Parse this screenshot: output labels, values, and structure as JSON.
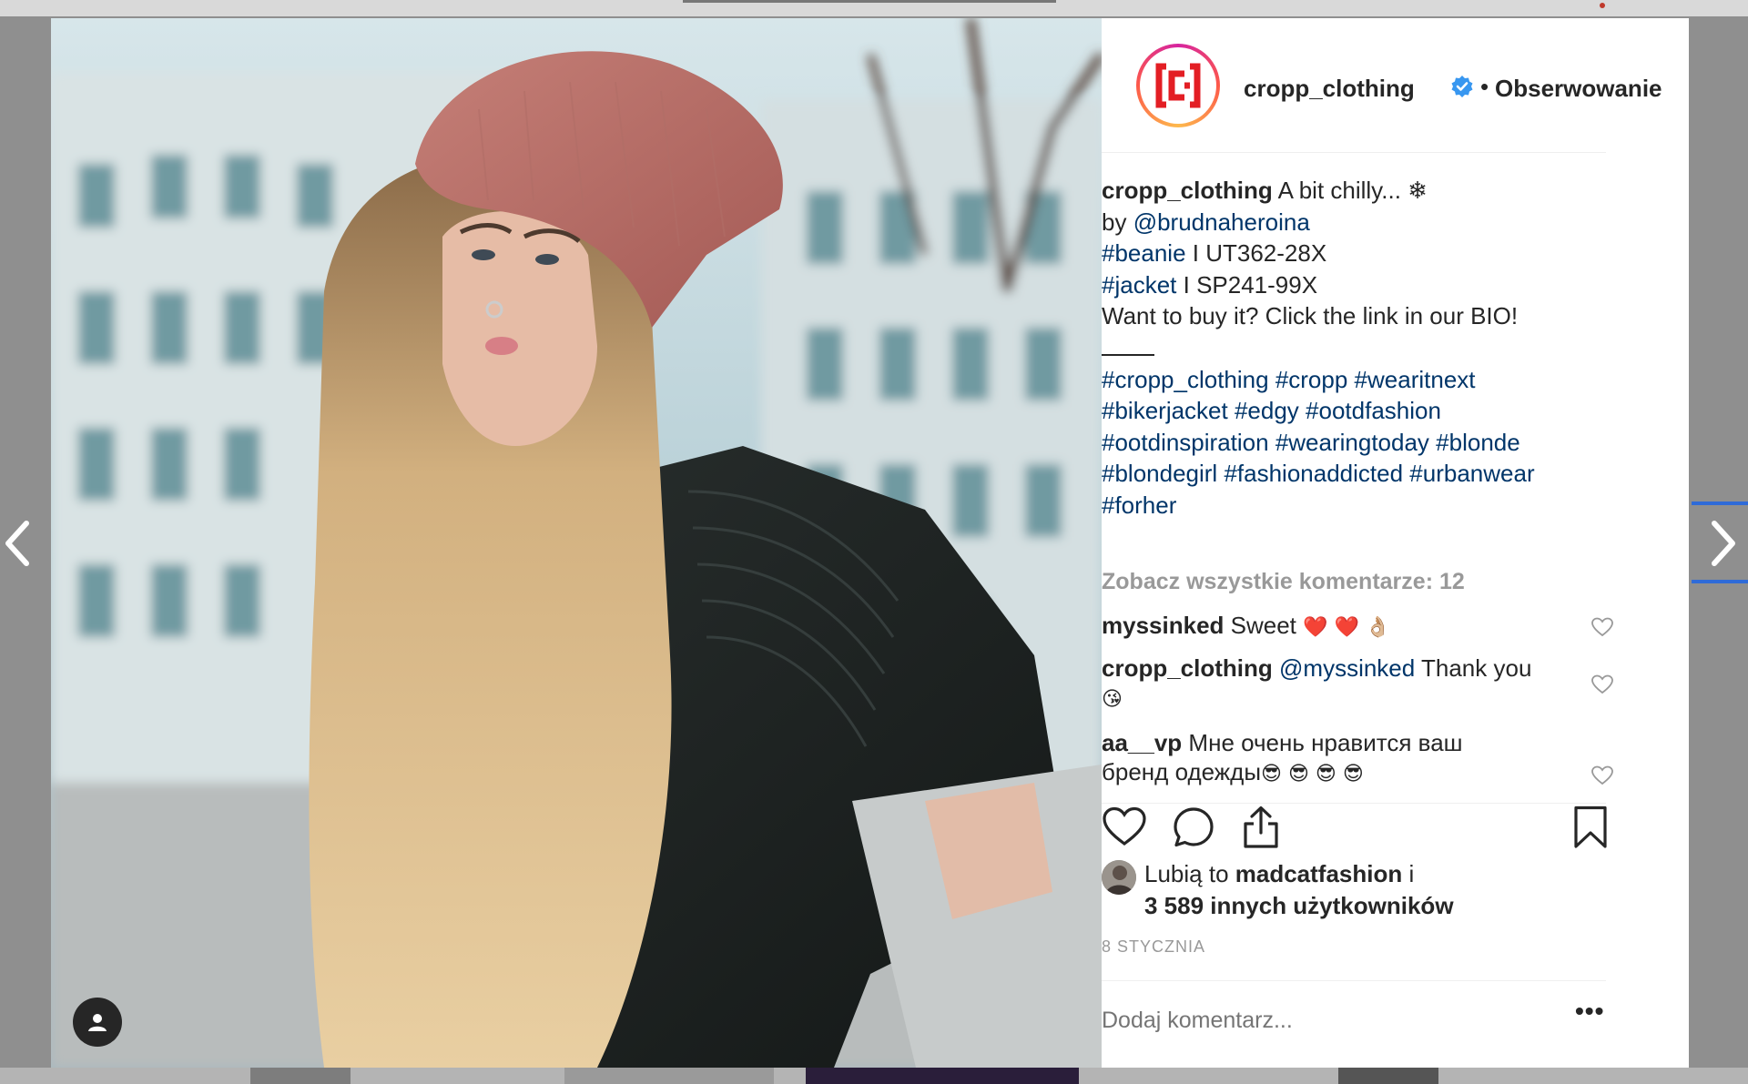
{
  "post": {
    "author": "cropp_clothing",
    "follow_status": "Obserwowanie",
    "separator": "•",
    "caption": {
      "author": "cropp_clothing",
      "text_1": "A bit chilly... ❄",
      "by_prefix": "by",
      "by_mention": "@brudnaheroina",
      "line_beanie_tag": "#beanie",
      "line_beanie_code": "I UT362-28X",
      "line_jacket_tag": "#jacket",
      "line_jacket_code": "I SP241-99X",
      "cta": "Want to buy it? Click the link in our BIO!",
      "hashtags": [
        [
          "#cropp_clothing",
          "#cropp",
          "#wearitnext"
        ],
        [
          "#bikerjacket",
          "#edgy",
          "#ootdfashion"
        ],
        [
          "#ootdinspiration",
          "#wearingtoday",
          "#blonde"
        ],
        [
          "#blondegirl",
          "#fashionaddicted",
          "#urbanwear"
        ],
        [
          "#forher"
        ]
      ]
    },
    "view_all_comments": "Zobacz wszystkie komentarze: 12",
    "comments": [
      {
        "user": "myssinked",
        "text": "Sweet",
        "emoji": "❤️ ❤️ 👌🏼"
      },
      {
        "user": "cropp_clothing",
        "mention": "@myssinked",
        "text": "Thank you",
        "emoji": "😘"
      },
      {
        "user": "aa__vp",
        "text": "Мне очень нравится ваш",
        "text_2": "бренд одежды",
        "emoji": "😎 😎 😎 😎"
      }
    ],
    "likes": {
      "prefix": "Lubią to",
      "user": "madcatfashion",
      "suffix": "i",
      "others": "3 589 innych użytkowników"
    },
    "date": "8 STYCZNIA",
    "add_comment_placeholder": "Dodaj komentarz...",
    "more_label": "•••"
  },
  "icons": {
    "prev": "chevron-left-icon",
    "next": "chevron-right-icon",
    "like": "heart-icon",
    "comment": "comment-bubble-icon",
    "share": "share-icon",
    "save": "bookmark-icon",
    "verified": "verified-badge-icon",
    "tagged_users": "user-icon"
  },
  "colors": {
    "link": "#003569",
    "text": "#262626",
    "muted": "#999999",
    "verified": "#3897f0",
    "brand_red": "#e31e24"
  }
}
